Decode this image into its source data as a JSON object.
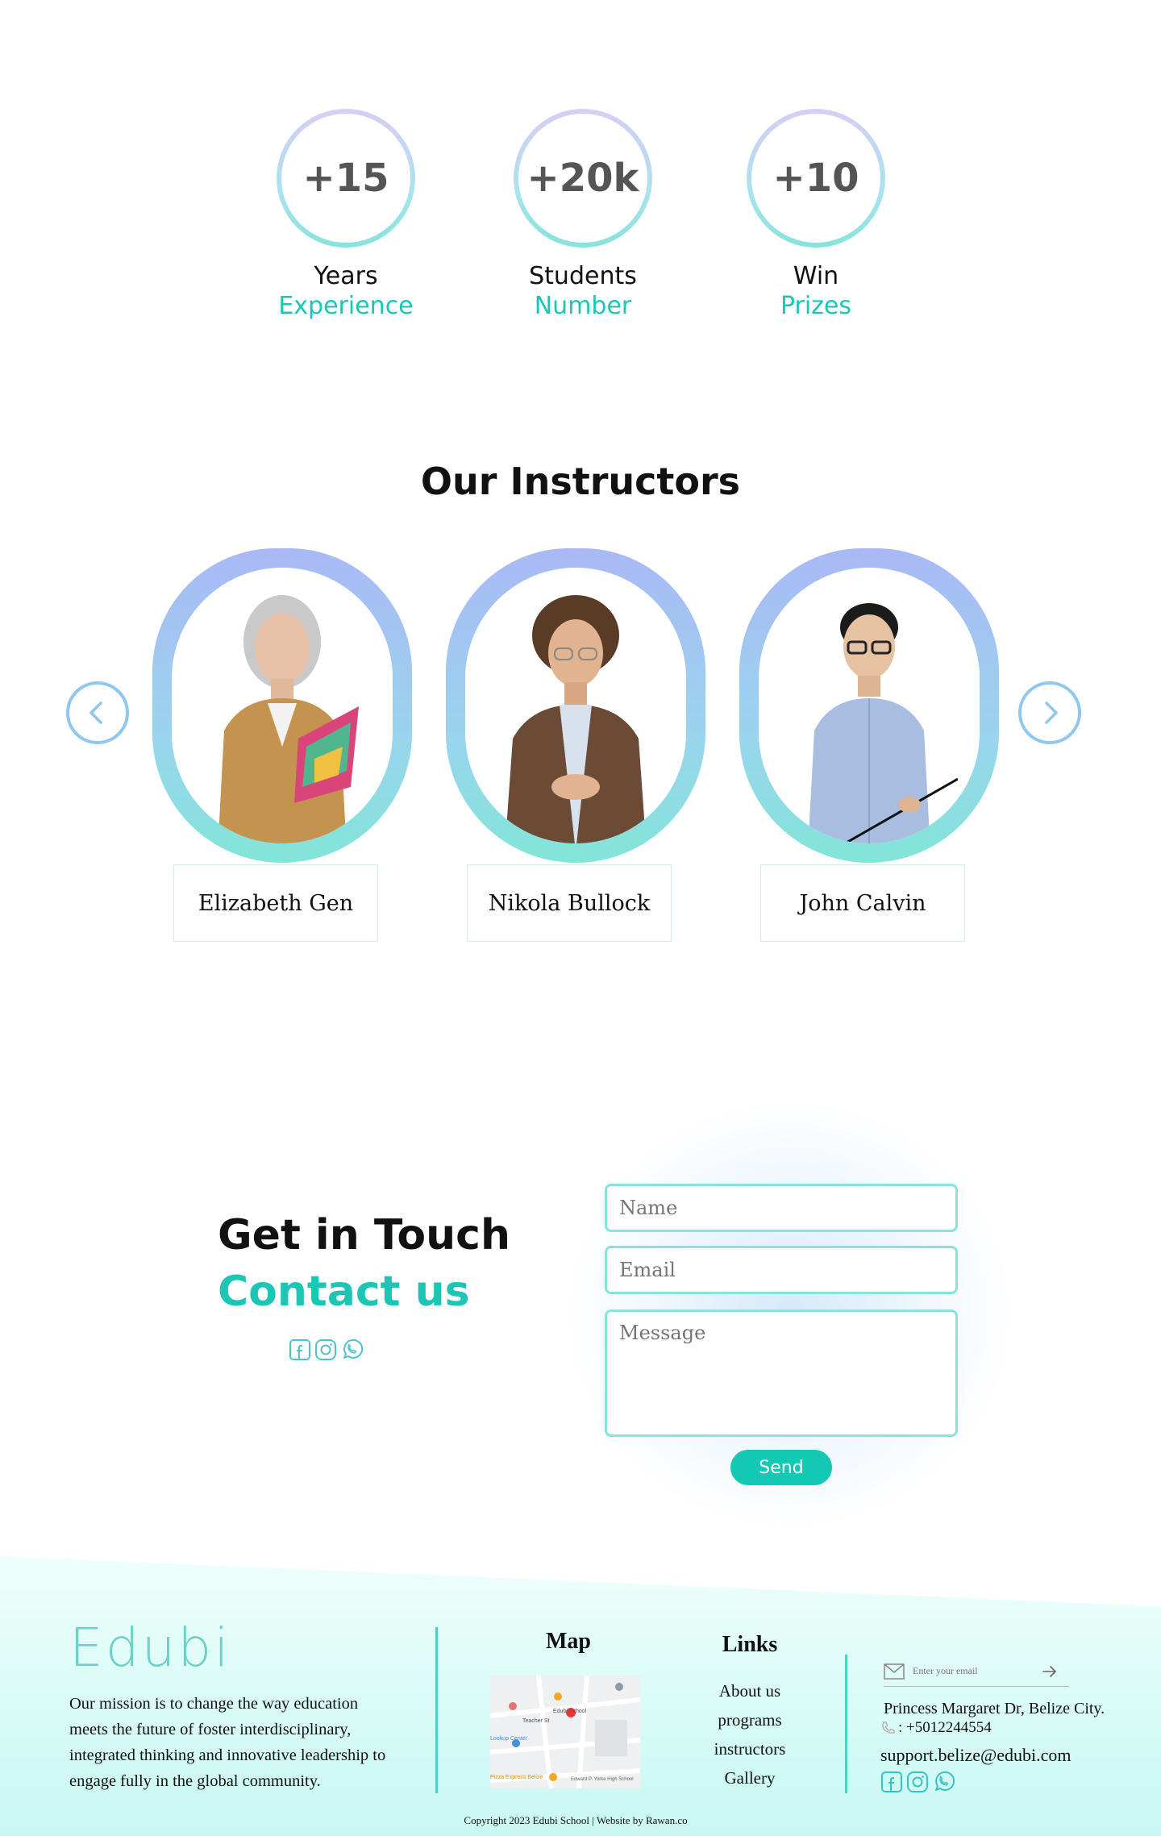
{
  "colors": {
    "accent": "#1dc6b4",
    "frame_top": "#a9b9f5",
    "frame_bottom": "#82e5d8"
  },
  "stats": [
    {
      "value": "+15",
      "line1": "Years",
      "line2": "Experience"
    },
    {
      "value": "+20k",
      "line1": "Students",
      "line2": "Number"
    },
    {
      "value": "+10",
      "line1": "Win",
      "line2": "Prizes"
    }
  ],
  "instructors": {
    "title": "Our Instructors",
    "items": [
      {
        "name": "Elizabeth Gen"
      },
      {
        "name": "Nikola Bullock"
      },
      {
        "name": "John Calvin"
      }
    ],
    "prev_icon": "chevron-left-icon",
    "next_icon": "chevron-right-icon"
  },
  "contact": {
    "title": "Get in Touch",
    "subtitle": "Contact us",
    "social_icons": [
      "facebook-icon",
      "instagram-icon",
      "whatsapp-icon"
    ],
    "form": {
      "name_placeholder": "Name",
      "email_placeholder": "Email",
      "message_placeholder": "Message",
      "send_label": "Send"
    }
  },
  "footer": {
    "logo": "Edubi",
    "mission": "Our mission is to change the way education meets the future of foster interdisciplinary, integrated thinking and innovative leadership to engage fully in the global community.",
    "map_title": "Map",
    "map_labels": {
      "pin1": "Edubi School",
      "street": "Teacher St",
      "ave": "Apple Tree Ave",
      "bottom": "Edward P. Yorke High School",
      "left": "Lookup Center",
      "pizza": "Pizza Express Belize"
    },
    "links_title": "Links",
    "links": [
      "About us",
      "programs",
      "instructors",
      "Gallery"
    ],
    "newsletter_placeholder": "Enter your email",
    "address": "Princess Margaret Dr, Belize City.",
    "phone": ": +5012244554",
    "email": "support.belize@edubi.com",
    "copyright": "Copyright 2023 Edubi School | Website by Rawan.co"
  }
}
